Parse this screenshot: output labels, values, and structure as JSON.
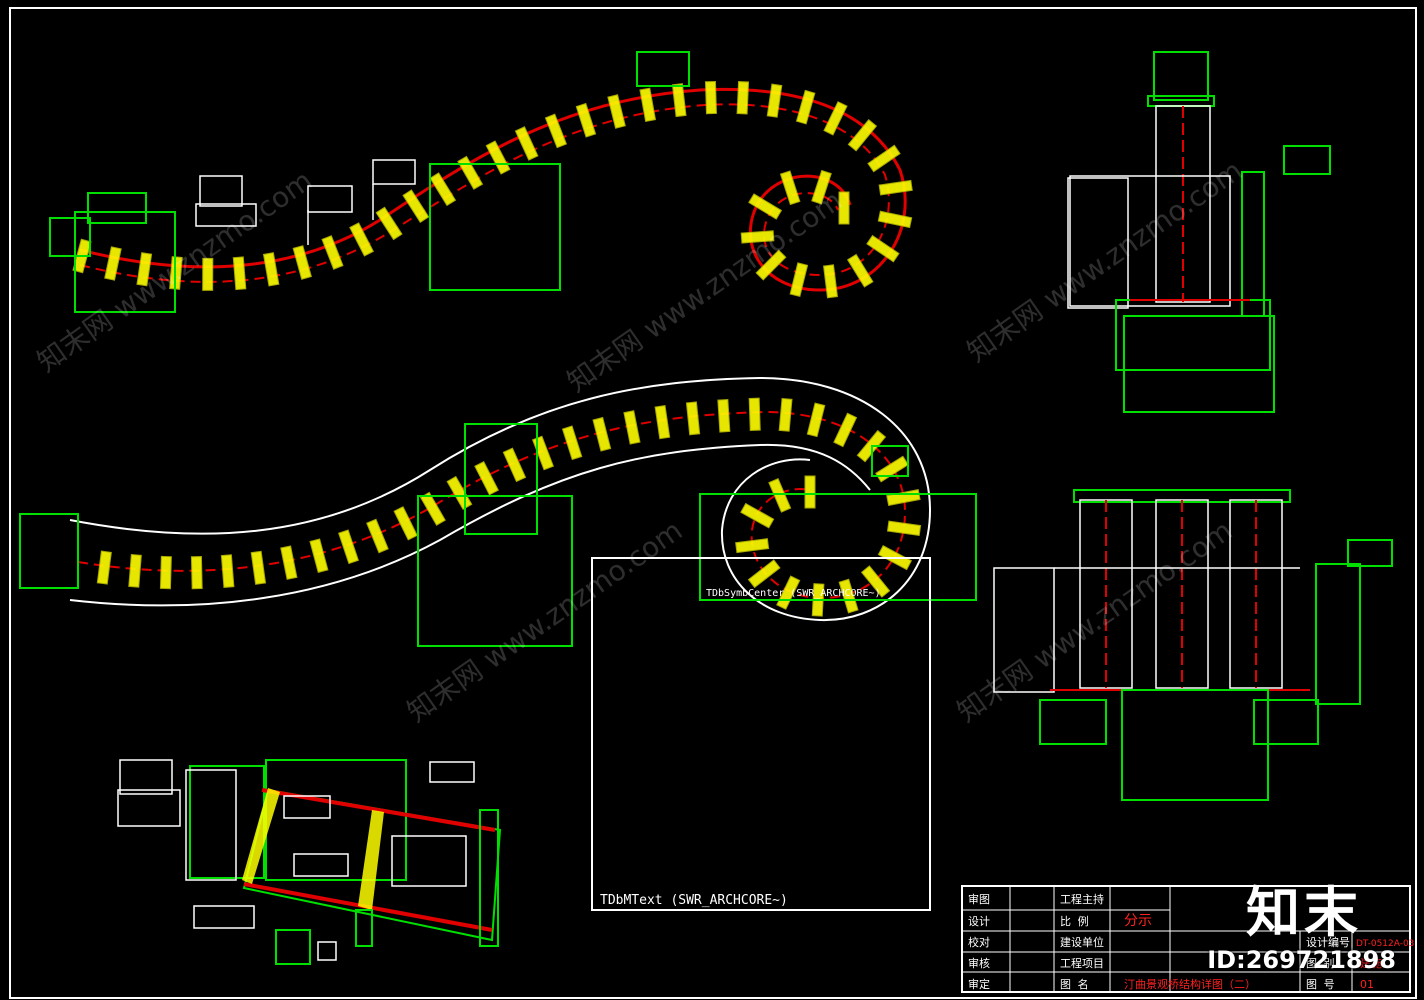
{
  "drawing": {
    "mtext_label": "TDbMText (SWR_ARCHCORE~)",
    "mtext_label_small": "TDbSymbCenter (SWR_ARCHCORE~)"
  },
  "title_block": {
    "rows": [
      {
        "c1": "审图",
        "c2": "工程主持"
      },
      {
        "c1": "设计",
        "c2": "比  例",
        "c3": "分示"
      },
      {
        "c1": "校对",
        "c2": "建设单位",
        "c4": "设计编号",
        "c5": "DT-0512A-03"
      },
      {
        "c1": "审核",
        "c2": "工程项目",
        "c4": "图  别",
        "c5": "建施"
      },
      {
        "c1": "审定",
        "c2": "图  名",
        "c3": "汀曲景观桥结构详图（二）",
        "c4": "图  号",
        "c5": "01"
      }
    ]
  },
  "watermark": {
    "text": "知末网 www.znzmo.com",
    "brand": "知末",
    "id_label": "ID:269721898"
  },
  "colors": {
    "frame": "#ffffff",
    "tray": "#00e000",
    "centerline": "#e00000",
    "stone": "#ffff00",
    "path": "#ffffff"
  }
}
